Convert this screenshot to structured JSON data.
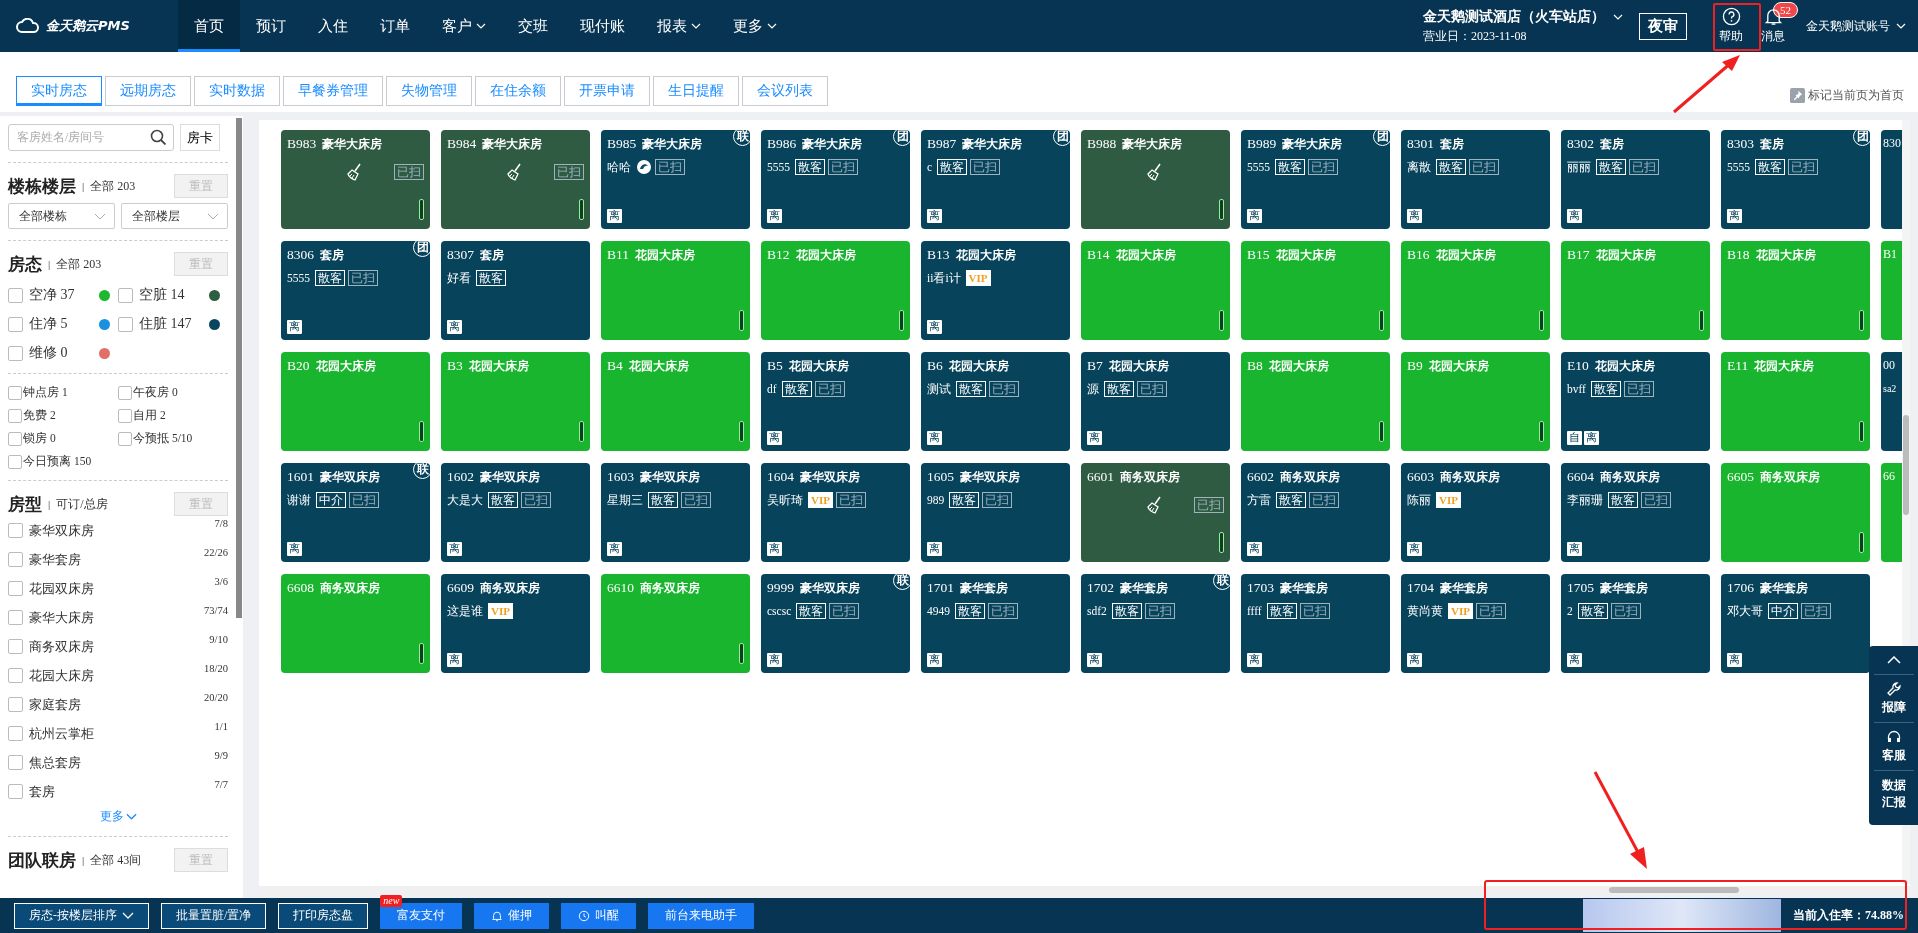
{
  "topbar": {
    "logo": "金天鹅云PMS",
    "nav": [
      {
        "label": "首页",
        "selected": true,
        "dropdown": false
      },
      {
        "label": "预订",
        "selected": false,
        "dropdown": false
      },
      {
        "label": "入住",
        "selected": false,
        "dropdown": false
      },
      {
        "label": "订单",
        "selected": false,
        "dropdown": false
      },
      {
        "label": "客户",
        "selected": false,
        "dropdown": true
      },
      {
        "label": "交班",
        "selected": false,
        "dropdown": false
      },
      {
        "label": "现付账",
        "selected": false,
        "dropdown": false
      },
      {
        "label": "报表",
        "selected": false,
        "dropdown": true
      },
      {
        "label": "更多",
        "selected": false,
        "dropdown": true
      }
    ],
    "hotel": "金天鹅测试酒店（火车站店）",
    "business_day": "营业日：2023-11-08",
    "night_audit": "夜审",
    "help": "帮助",
    "messages": "消息",
    "message_count": "52",
    "account": "金天鹅测试账号"
  },
  "tabs": [
    {
      "label": "实时房态",
      "selected": true
    },
    {
      "label": "远期房态",
      "selected": false
    },
    {
      "label": "实时数据",
      "selected": false
    },
    {
      "label": "早餐券管理",
      "selected": false
    },
    {
      "label": "失物管理",
      "selected": false
    },
    {
      "label": "在住余额",
      "selected": false
    },
    {
      "label": "开票申请",
      "selected": false
    },
    {
      "label": "生日提醒",
      "selected": false
    },
    {
      "label": "会议列表",
      "selected": false
    }
  ],
  "set_home": "标记当前页为首页",
  "sidebar": {
    "search": {
      "placeholder": "客房姓名/房间号"
    },
    "room_card": "房卡",
    "building": {
      "title": "楼栋楼层",
      "separator": "|",
      "summary": "全部 203",
      "reset": {
        "label": "重置",
        "disabled": true
      },
      "selects": [
        "全部楼栋",
        "全部楼层"
      ]
    },
    "status": {
      "title": "房态",
      "separator": "|",
      "summary": "全部 203",
      "reset": {
        "label": "重置",
        "disabled": true
      },
      "items": [
        {
          "label": "空净 37",
          "checked": false,
          "color": "#1db830"
        },
        {
          "label": "空脏 14",
          "checked": false,
          "color": "#2e5e40"
        },
        {
          "label": "住净 5",
          "checked": false,
          "color": "#1a90e0"
        },
        {
          "label": "住脏 147",
          "checked": false,
          "color": "#0a4560"
        },
        {
          "label": "维修 0",
          "checked": false,
          "color": "#e07066"
        }
      ],
      "flags": [
        {
          "label": "钟点房 1",
          "checked": false
        },
        {
          "label": "午夜房 0",
          "checked": false
        },
        {
          "label": "免费 2",
          "checked": false
        },
        {
          "label": "自用 2",
          "checked": false
        },
        {
          "label": "锁房 0",
          "checked": false
        },
        {
          "label": "今预抵 5/10",
          "checked": false
        },
        {
          "label": "今日预离 150",
          "checked": false
        }
      ]
    },
    "room_types": {
      "title": "房型",
      "separator": "|",
      "summary": "可订/总房",
      "reset": {
        "label": "重置",
        "disabled": true
      },
      "items": [
        {
          "label": "豪华双床房",
          "count": "7/8",
          "checked": false
        },
        {
          "label": "豪华套房",
          "count": "22/26",
          "checked": false
        },
        {
          "label": "花园双床房",
          "count": "3/6",
          "checked": false
        },
        {
          "label": "豪华大床房",
          "count": "73/74",
          "checked": false
        },
        {
          "label": "商务双床房",
          "count": "9/10",
          "checked": false
        },
        {
          "label": "花园大床房",
          "count": "18/20",
          "checked": false
        },
        {
          "label": "家庭套房",
          "count": "20/20",
          "checked": false
        },
        {
          "label": "杭州云掌柜",
          "count": "1/1",
          "checked": false
        },
        {
          "label": "焦总套房",
          "count": "9/9",
          "checked": false
        },
        {
          "label": "套房",
          "count": "7/7",
          "checked": false
        }
      ],
      "more": "更多"
    },
    "groups": {
      "title": "团队联房",
      "separator": "|",
      "summary": "全部 43间",
      "reset": {
        "label": "重置",
        "disabled": true
      }
    }
  },
  "room_rows": [
    {
      "rooms": [
        {
          "number": "B983",
          "type": "豪华大床房",
          "kind": "dirty",
          "tags": [
            {
              "text": "已扫",
              "kind": "muted"
            }
          ]
        },
        {
          "number": "B984",
          "type": "豪华大床房",
          "kind": "dirty",
          "tags": [
            {
              "text": "已扫",
              "kind": "muted"
            }
          ]
        },
        {
          "number": "B985",
          "type": "豪华大床房",
          "kind": "occupied",
          "corner": "联",
          "guest": "哈哈",
          "tags": [
            {
              "kind": "icon"
            },
            {
              "text": "已扫",
              "kind": "muted"
            }
          ],
          "badges": [
            "离"
          ]
        },
        {
          "number": "B986",
          "type": "豪华大床房",
          "kind": "occupied",
          "corner": "团",
          "guest": "5555",
          "tags": [
            {
              "text": "散客",
              "kind": "solid"
            },
            {
              "text": "已扫",
              "kind": "muted"
            }
          ],
          "badges": [
            "离"
          ]
        },
        {
          "number": "B987",
          "type": "豪华大床房",
          "kind": "occupied",
          "corner": "团",
          "guest": "c",
          "tags": [
            {
              "text": "散客",
              "kind": "solid"
            },
            {
              "text": "已扫",
              "kind": "muted"
            }
          ],
          "badges": [
            "离"
          ]
        },
        {
          "number": "B988",
          "type": "豪华大床房",
          "kind": "dirty"
        },
        {
          "number": "B989",
          "type": "豪华大床房",
          "kind": "occupied",
          "corner": "团",
          "guest": "5555",
          "tags": [
            {
              "text": "散客",
              "kind": "solid"
            },
            {
              "text": "已扫",
              "kind": "muted"
            }
          ],
          "badges": [
            "离"
          ]
        },
        {
          "number": "8301",
          "type": "套房",
          "kind": "occupied",
          "guest": "离散",
          "tags": [
            {
              "text": "散客",
              "kind": "solid"
            },
            {
              "text": "已扫",
              "kind": "muted"
            }
          ],
          "badges": [
            "离"
          ]
        },
        {
          "number": "8302",
          "type": "套房",
          "kind": "occupied",
          "guest": "丽丽",
          "tags": [
            {
              "text": "散客",
              "kind": "solid"
            },
            {
              "text": "已扫",
              "kind": "muted"
            }
          ],
          "badges": [
            "离"
          ]
        },
        {
          "number": "8303",
          "type": "套房",
          "kind": "occupied",
          "corner": "团",
          "guest": "5555",
          "tags": [
            {
              "text": "散客",
              "kind": "solid"
            },
            {
              "text": "已扫",
              "kind": "muted"
            }
          ],
          "badges": [
            "离"
          ]
        }
      ],
      "edge_room": {
        "number": "830",
        "kind": "occupied"
      }
    },
    {
      "rooms": [
        {
          "number": "8306",
          "type": "套房",
          "kind": "occupied",
          "corner": "团",
          "guest": "5555",
          "tags": [
            {
              "text": "散客",
              "kind": "solid"
            },
            {
              "text": "已扫",
              "kind": "muted"
            }
          ],
          "badges": [
            "离"
          ]
        },
        {
          "number": "8307",
          "type": "套房",
          "kind": "occupied",
          "guest": "好看",
          "tags": [
            {
              "text": "散客",
              "kind": "solid"
            }
          ],
          "badges": [
            "离"
          ]
        },
        {
          "number": "B11",
          "type": "花园大床房",
          "kind": "clean"
        },
        {
          "number": "B12",
          "type": "花园大床房",
          "kind": "clean"
        },
        {
          "number": "B13",
          "type": "花园大床房",
          "kind": "occupied",
          "guest": "ii看i计",
          "tags": [
            {
              "text": "VIP",
              "kind": "vip"
            }
          ],
          "badges": [
            "离"
          ]
        },
        {
          "number": "B14",
          "type": "花园大床房",
          "kind": "clean"
        },
        {
          "number": "B15",
          "type": "花园大床房",
          "kind": "clean"
        },
        {
          "number": "B16",
          "type": "花园大床房",
          "kind": "clean"
        },
        {
          "number": "B17",
          "type": "花园大床房",
          "kind": "clean"
        },
        {
          "number": "B18",
          "type": "花园大床房",
          "kind": "clean"
        }
      ],
      "edge_room": {
        "number": "B1",
        "kind": "clean"
      }
    },
    {
      "rooms": [
        {
          "number": "B20",
          "type": "花园大床房",
          "kind": "clean"
        },
        {
          "number": "B3",
          "type": "花园大床房",
          "kind": "clean"
        },
        {
          "number": "B4",
          "type": "花园大床房",
          "kind": "clean"
        },
        {
          "number": "B5",
          "type": "花园大床房",
          "kind": "occupied",
          "guest": "df",
          "tags": [
            {
              "text": "散客",
              "kind": "solid"
            },
            {
              "text": "已扫",
              "kind": "muted"
            }
          ],
          "badges": [
            "离"
          ]
        },
        {
          "number": "B6",
          "type": "花园大床房",
          "kind": "occupied",
          "guest": "测试",
          "tags": [
            {
              "text": "散客",
              "kind": "solid"
            },
            {
              "text": "已扫",
              "kind": "muted"
            }
          ],
          "badges": [
            "离"
          ]
        },
        {
          "number": "B7",
          "type": "花园大床房",
          "kind": "occupied",
          "guest": "源",
          "tags": [
            {
              "text": "散客",
              "kind": "solid"
            },
            {
              "text": "已扫",
              "kind": "muted"
            }
          ],
          "badges": [
            "离"
          ]
        },
        {
          "number": "B8",
          "type": "花园大床房",
          "kind": "clean"
        },
        {
          "number": "B9",
          "type": "花园大床房",
          "kind": "clean"
        },
        {
          "number": "E10",
          "type": "花园大床房",
          "kind": "occupied",
          "guest": "bvff",
          "tags": [
            {
              "text": "散客",
              "kind": "solid"
            },
            {
              "text": "已扫",
              "kind": "muted"
            }
          ],
          "badges": [
            "自",
            "离"
          ]
        },
        {
          "number": "E11",
          "type": "花园大床房",
          "kind": "clean"
        }
      ],
      "edge_room": {
        "number": "00",
        "guest": "sa2",
        "kind": "occupied"
      }
    },
    {
      "rooms": [
        {
          "number": "1601",
          "type": "豪华双床房",
          "kind": "occupied",
          "corner": "联",
          "guest": "谢谢",
          "tags": [
            {
              "text": "中介",
              "kind": "solid"
            },
            {
              "text": "已扫",
              "kind": "muted"
            }
          ],
          "badges": [
            "离"
          ]
        },
        {
          "number": "1602",
          "type": "豪华双床房",
          "kind": "occupied",
          "guest": "大是大",
          "tags": [
            {
              "text": "散客",
              "kind": "solid"
            },
            {
              "text": "已扫",
              "kind": "muted"
            }
          ],
          "badges": [
            "离"
          ]
        },
        {
          "number": "1603",
          "type": "豪华双床房",
          "kind": "occupied",
          "guest": "星期三",
          "tags": [
            {
              "text": "散客",
              "kind": "solid"
            },
            {
              "text": "已扫",
              "kind": "muted"
            }
          ],
          "badges": [
            "离"
          ]
        },
        {
          "number": "1604",
          "type": "豪华双床房",
          "kind": "occupied",
          "guest": "吴昕琦",
          "tags": [
            {
              "text": "VIP",
              "kind": "vip"
            },
            {
              "text": "已扫",
              "kind": "muted"
            }
          ],
          "badges": [
            "离"
          ]
        },
        {
          "number": "1605",
          "type": "豪华双床房",
          "kind": "occupied",
          "guest": "989",
          "tags": [
            {
              "text": "散客",
              "kind": "solid"
            },
            {
              "text": "已扫",
              "kind": "muted"
            }
          ],
          "badges": [
            "离"
          ]
        },
        {
          "number": "6601",
          "type": "商务双床房",
          "kind": "dirty",
          "tags": [
            {
              "text": "已扫",
              "kind": "muted"
            }
          ]
        },
        {
          "number": "6602",
          "type": "商务双床房",
          "kind": "occupied",
          "guest": "方雷",
          "tags": [
            {
              "text": "散客",
              "kind": "solid"
            },
            {
              "text": "已扫",
              "kind": "muted"
            }
          ],
          "badges": [
            "离"
          ]
        },
        {
          "number": "6603",
          "type": "商务双床房",
          "kind": "occupied",
          "guest": "陈丽",
          "tags": [
            {
              "text": "VIP",
              "kind": "vip"
            }
          ],
          "badges": [
            "离"
          ]
        },
        {
          "number": "6604",
          "type": "商务双床房",
          "kind": "occupied",
          "guest": "李丽珊",
          "tags": [
            {
              "text": "散客",
              "kind": "solid"
            },
            {
              "text": "已扫",
              "kind": "muted"
            }
          ],
          "badges": [
            "离"
          ]
        },
        {
          "number": "6605",
          "type": "商务双床房",
          "kind": "clean"
        }
      ],
      "edge_room": {
        "number": "66",
        "kind": "clean"
      }
    },
    {
      "rooms": [
        {
          "number": "6608",
          "type": "商务双床房",
          "kind": "clean"
        },
        {
          "number": "6609",
          "type": "商务双床房",
          "kind": "occupied",
          "guest": "这是谁",
          "tags": [
            {
              "text": "VIP",
              "kind": "vip"
            }
          ],
          "badges": [
            "离"
          ]
        },
        {
          "number": "6610",
          "type": "商务双床房",
          "kind": "clean"
        },
        {
          "number": "9999",
          "type": "豪华双床房",
          "kind": "occupied",
          "corner": "联",
          "guest": "cscsc",
          "tags": [
            {
              "text": "散客",
              "kind": "solid"
            },
            {
              "text": "已扫",
              "kind": "muted"
            }
          ],
          "badges": [
            "离"
          ]
        },
        {
          "number": "1701",
          "type": "豪华套房",
          "kind": "occupied",
          "guest": "4949",
          "tags": [
            {
              "text": "散客",
              "kind": "solid"
            },
            {
              "text": "已扫",
              "kind": "muted"
            }
          ],
          "badges": [
            "离"
          ]
        },
        {
          "number": "1702",
          "type": "豪华套房",
          "kind": "occupied",
          "corner": "联",
          "guest": "sdf2",
          "tags": [
            {
              "text": "散客",
              "kind": "solid"
            },
            {
              "text": "已扫",
              "kind": "muted"
            }
          ],
          "badges": [
            "离"
          ]
        },
        {
          "number": "1703",
          "type": "豪华套房",
          "kind": "occupied",
          "guest": "ffff",
          "tags": [
            {
              "text": "散客",
              "kind": "solid"
            },
            {
              "text": "已扫",
              "kind": "muted"
            }
          ],
          "badges": [
            "离"
          ]
        },
        {
          "number": "1704",
          "type": "豪华套房",
          "kind": "occupied",
          "guest": "黄尚黄",
          "tags": [
            {
              "text": "VIP",
              "kind": "vip"
            },
            {
              "text": "已扫",
              "kind": "muted"
            }
          ],
          "badges": [
            "离"
          ]
        },
        {
          "number": "1705",
          "type": "豪华套房",
          "kind": "occupied",
          "guest": "2",
          "tags": [
            {
              "text": "散客",
              "kind": "solid"
            },
            {
              "text": "已扫",
              "kind": "muted"
            }
          ],
          "badges": [
            "离"
          ]
        },
        {
          "number": "1706",
          "type": "豪华套房",
          "kind": "occupied",
          "guest": "邓大哥",
          "tags": [
            {
              "text": "中介",
              "kind": "solid"
            },
            {
              "text": "已扫",
              "kind": "muted"
            }
          ],
          "badges": [
            "离"
          ]
        }
      ]
    }
  ],
  "side_tools": [
    {
      "label": "报障",
      "kind": "wrench"
    },
    {
      "label": "客服",
      "kind": "headset"
    },
    {
      "label": "数据汇报",
      "kind": "text"
    }
  ],
  "bottom_bar": {
    "buttons": [
      {
        "label": "房态-按楼层排序",
        "kind": "dropdown"
      },
      {
        "label": "批量置脏/置净",
        "kind": "outline"
      },
      {
        "label": "打印房态盘",
        "kind": "outline"
      },
      {
        "label": "富友支付",
        "kind": "new",
        "badge": "new"
      },
      {
        "label": "催押",
        "kind": "bell"
      },
      {
        "label": "叫醒",
        "kind": "clock"
      },
      {
        "label": "前台来电助手",
        "kind": "plain"
      }
    ],
    "occupancy": "当前入住率：74.88%"
  }
}
